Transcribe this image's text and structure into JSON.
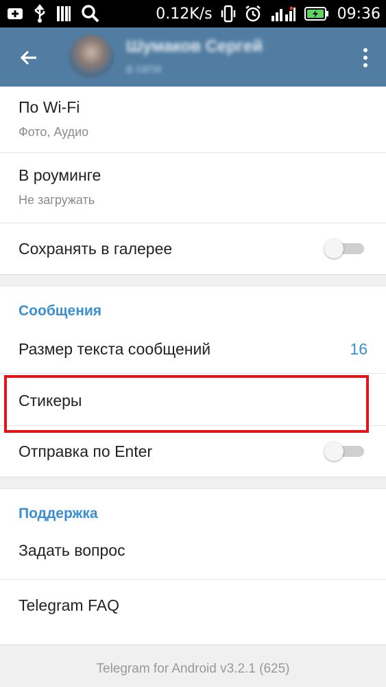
{
  "status_bar": {
    "speed": "0.12K/s",
    "time": "09:36",
    "battery_color": "#5fd35f",
    "icons": [
      "add-icon",
      "usb-icon",
      "signal-bars-icon",
      "search-icon",
      "vibrate-icon",
      "alarm-icon",
      "mobile-signal-icon",
      "battery-icon"
    ]
  },
  "app_bar": {
    "background": "#517da2",
    "title": "Шумаков Сергей",
    "status": "в сети"
  },
  "rows": {
    "wifi": {
      "title": "По Wi-Fi",
      "subtitle": "Фото, Аудио"
    },
    "roaming": {
      "title": "В роуминге",
      "subtitle": "Не загружать"
    },
    "save_gallery": {
      "title": "Сохранять в галерее",
      "toggle_on": false
    },
    "messages_header": "Сообщения",
    "text_size": {
      "title": "Размер текста сообщений",
      "value": "16"
    },
    "stickers": {
      "title": "Стикеры"
    },
    "send_enter": {
      "title": "Отправка по Enter",
      "toggle_on": false
    },
    "support_header": "Поддержка",
    "ask_question": {
      "title": "Задать вопрос"
    },
    "faq": {
      "title": "Telegram FAQ"
    }
  },
  "footer": {
    "version": "Telegram for Android v3.2.1 (625)"
  },
  "colors": {
    "accent": "#3a8fd0",
    "highlight": "#e4141a"
  }
}
